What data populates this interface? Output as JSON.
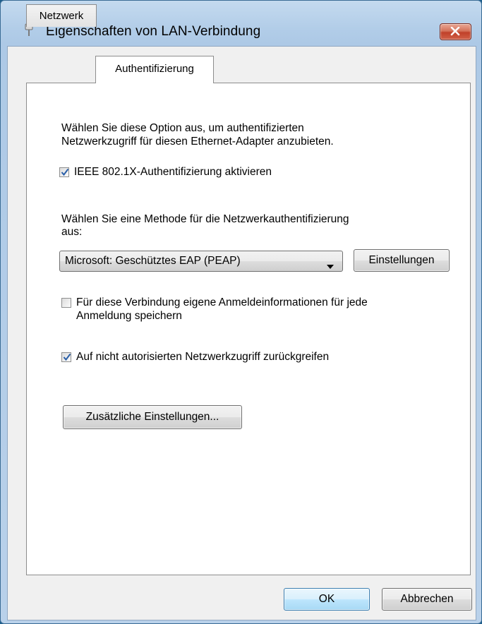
{
  "window": {
    "title": "Eigenschaften von LAN-Verbindung"
  },
  "tabs": [
    {
      "label": "Netzwerk",
      "active": false
    },
    {
      "label": "Authentifizierung",
      "active": true
    }
  ],
  "authentication": {
    "intro_line1": "Wählen Sie diese Option aus, um authentifizierten",
    "intro_line2": "Netzwerkzugriff für diesen Ethernet-Adapter anzubieten.",
    "enable_8021x": {
      "label": "IEEE 802.1X-Authentifizierung aktivieren",
      "checked": true
    },
    "method_label_line1": "Wählen Sie eine Methode für die Netzwerkauthentifizierung",
    "method_label_line2": "aus:",
    "method_select": {
      "value": "Microsoft: Geschütztes EAP (PEAP)"
    },
    "settings_button": "Einstellungen",
    "remember_credentials": {
      "label_line1": "Für diese Verbindung eigene Anmeldeinformationen für jede",
      "label_line2": "Anmeldung speichern",
      "checked": false
    },
    "fallback_unauthorized": {
      "label": "Auf nicht autorisierten Netzwerkzugriff zurückgreifen",
      "checked": true
    },
    "additional_settings_button": "Zusätzliche Einstellungen..."
  },
  "footer": {
    "ok_label": "OK",
    "cancel_label": "Abbrechen"
  },
  "icons": {
    "title_icon": "network-plug-icon",
    "close_icon": "close-icon",
    "dropdown_icon": "chevron-down-icon",
    "check_icon": "checkmark-icon"
  },
  "colors": {
    "close_button": "#c0412a",
    "checkmark": "#2a5fa8",
    "default_button_border": "#3c7fb1"
  }
}
